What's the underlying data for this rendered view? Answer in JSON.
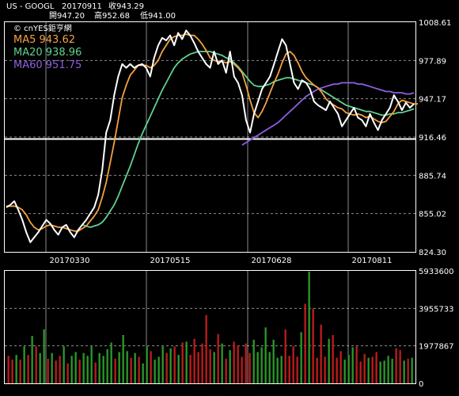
{
  "header": {
    "symbol": "US - GOOGL",
    "date": "20170911",
    "close_label": "收943.29",
    "open_label": "開947.20",
    "high_label": "高952.68",
    "low_label": "低941.00"
  },
  "watermark": "© cnYES鉅亨網",
  "legend": [
    {
      "label": "MA5 943.62",
      "color": "#f5a242"
    },
    {
      "label": "MA20 938.96",
      "color": "#5fd38e"
    },
    {
      "label": "MA60 951.75",
      "color": "#8f5fe0"
    }
  ],
  "colors": {
    "price": "#ffffff",
    "ma5": "#f5a242",
    "ma20": "#5fd38e",
    "ma60": "#8f5fe0",
    "vol_up": "#2a9a2a",
    "vol_down": "#c01c1c",
    "grid": "#ffffff"
  },
  "chart_data": [
    {
      "type": "line",
      "title": "US - GOOGL",
      "x_ticks": [
        "20170330",
        "20170515",
        "20170628",
        "20170811"
      ],
      "y_ticks": [
        "1008.61",
        "977.89",
        "947.17",
        "916.46",
        "885.74",
        "855.02",
        "824.30"
      ],
      "ylim": [
        824.3,
        1008.61
      ],
      "grid": true,
      "series": [
        {
          "name": "收",
          "values": [
            860,
            862,
            865,
            858,
            850,
            840,
            832,
            836,
            840,
            845,
            850,
            847,
            842,
            838,
            844,
            846,
            840,
            836,
            842,
            846,
            850,
            855,
            860,
            870,
            890,
            920,
            930,
            950,
            965,
            975,
            972,
            975,
            972,
            974,
            975,
            972,
            965,
            980,
            990,
            996,
            994,
            998,
            990,
            1000,
            995,
            1002,
            998,
            992,
            985,
            980,
            975,
            972,
            985,
            975,
            978,
            968,
            985,
            965,
            960,
            950,
            930,
            920,
            935,
            945,
            955,
            960,
            965,
            975,
            985,
            995,
            990,
            975,
            960,
            955,
            962,
            960,
            955,
            945,
            942,
            940,
            938,
            945,
            940,
            935,
            925,
            930,
            935,
            940,
            932,
            930,
            925,
            935,
            928,
            922,
            930,
            935,
            940,
            950,
            945,
            938,
            944,
            940,
            943
          ]
        },
        {
          "name": "MA5",
          "values": [
            861,
            861,
            861,
            860,
            858,
            854,
            848,
            844,
            842,
            843,
            845,
            846,
            845,
            844,
            844,
            843,
            842,
            841,
            841,
            843,
            845,
            849,
            853,
            858,
            868,
            880,
            896,
            912,
            930,
            948,
            958,
            966,
            970,
            974,
            974,
            974,
            972,
            974,
            978,
            985,
            990,
            995,
            997,
            998,
            998,
            999,
            998,
            998,
            995,
            991,
            986,
            980,
            978,
            977,
            977,
            976,
            977,
            975,
            972,
            968,
            958,
            946,
            936,
            932,
            937,
            944,
            952,
            960,
            967,
            976,
            983,
            985,
            982,
            976,
            969,
            964,
            961,
            958,
            956,
            952,
            947,
            944,
            942,
            940,
            939,
            936,
            935,
            934,
            935,
            934,
            932,
            933,
            931,
            929,
            928,
            929,
            933,
            937,
            943,
            946,
            945,
            944,
            943,
            943
          ]
        },
        {
          "name": "MA20",
          "values": [
            null,
            null,
            null,
            null,
            null,
            null,
            null,
            null,
            null,
            null,
            null,
            null,
            null,
            null,
            null,
            null,
            null,
            null,
            null,
            846,
            845,
            844,
            845,
            846,
            848,
            852,
            857,
            862,
            869,
            877,
            885,
            893,
            902,
            911,
            919,
            926,
            933,
            940,
            947,
            954,
            960,
            966,
            972,
            976,
            979,
            981,
            983,
            984,
            985,
            985,
            985,
            985,
            984,
            983,
            982,
            980,
            979,
            976,
            973,
            969,
            965,
            961,
            958,
            957,
            957,
            958,
            959,
            961,
            962,
            963,
            964,
            964,
            963,
            962,
            961,
            960,
            959,
            958,
            956,
            954,
            952,
            950,
            948,
            946,
            944,
            942,
            941,
            940,
            939,
            938,
            937,
            937,
            936,
            935,
            934,
            934,
            935,
            935,
            936,
            936,
            937,
            938,
            939
          ]
        },
        {
          "name": "MA60",
          "values": [
            null,
            null,
            null,
            null,
            null,
            null,
            null,
            null,
            null,
            null,
            null,
            null,
            null,
            null,
            null,
            null,
            null,
            null,
            null,
            null,
            null,
            null,
            null,
            null,
            null,
            null,
            null,
            null,
            null,
            null,
            null,
            null,
            null,
            null,
            null,
            null,
            null,
            null,
            null,
            null,
            null,
            null,
            null,
            null,
            null,
            null,
            null,
            null,
            null,
            null,
            null,
            null,
            null,
            null,
            null,
            null,
            null,
            null,
            null,
            910,
            912,
            914,
            916,
            918,
            920,
            922,
            924,
            926,
            928,
            931,
            934,
            937,
            940,
            943,
            946,
            949,
            951,
            953,
            955,
            956,
            957,
            958,
            959,
            959,
            960,
            960,
            960,
            960,
            959,
            959,
            958,
            957,
            956,
            955,
            954,
            953,
            953,
            952,
            952,
            952,
            951,
            951,
            952
          ]
        }
      ]
    },
    {
      "type": "bar",
      "title": "",
      "y_ticks": [
        "5933600",
        "3955733",
        "1977867",
        "0"
      ],
      "ylim": [
        0,
        5933600
      ],
      "grid": true,
      "series": [
        {
          "name": "volume",
          "values": [
            1450000,
            1250000,
            1500000,
            1250000,
            1950000,
            1500000,
            2500000,
            1950000,
            1600000,
            2850000,
            1300000,
            1600000,
            1200000,
            1450000,
            1950000,
            1050000,
            1450000,
            1650000,
            1250000,
            1600000,
            1450000,
            1950000,
            1100000,
            1600000,
            1450000,
            1800000,
            2150000,
            1300000,
            1650000,
            2550000,
            1700000,
            1350000,
            1600000,
            1400000,
            1050000,
            1950000,
            1700000,
            1250000,
            1400000,
            1950000,
            1600000,
            1850000,
            1950000,
            1500000,
            2150000,
            2200000,
            1500000,
            2350000,
            1650000,
            2100000,
            3600000,
            1800000,
            1650000,
            2600000,
            2100000,
            1300000,
            1750000,
            2200000,
            2000000,
            1400000,
            2100000,
            1600000,
            2300000,
            1650000,
            1900000,
            2950000,
            1650000,
            2300000,
            1350000,
            1450000,
            2850000,
            1450000,
            1950000,
            1400000,
            2700000,
            4200000,
            5900000,
            3950000,
            1350000,
            3100000,
            1400000,
            2350000,
            2550000,
            1350000,
            1700000,
            1250000,
            1500000,
            1900000,
            1950000,
            1150000,
            1550000,
            1350000,
            1400000,
            1650000,
            1150000,
            1200000,
            1450000,
            1300000,
            1850000,
            1750000,
            1200000,
            1300000,
            1350000
          ]
        },
        {
          "name": "up",
          "values": [
            0,
            0,
            1,
            0,
            1,
            0,
            1,
            0,
            1,
            1,
            0,
            1,
            0,
            0,
            1,
            0,
            1,
            1,
            0,
            1,
            1,
            1,
            0,
            1,
            1,
            1,
            1,
            0,
            1,
            1,
            1,
            0,
            1,
            0,
            1,
            1,
            0,
            1,
            1,
            1,
            0,
            1,
            0,
            1,
            0,
            1,
            0,
            0,
            0,
            0,
            0,
            0,
            1,
            0,
            1,
            0,
            1,
            0,
            0,
            0,
            0,
            0,
            1,
            1,
            1,
            1,
            1,
            1,
            1,
            1,
            0,
            0,
            0,
            0,
            1,
            0,
            1,
            0,
            0,
            0,
            0,
            1,
            0,
            0,
            0,
            1,
            1,
            1,
            0,
            0,
            0,
            1,
            0,
            0,
            1,
            1,
            1,
            1,
            0,
            0,
            1,
            0,
            1
          ]
        }
      ]
    }
  ]
}
